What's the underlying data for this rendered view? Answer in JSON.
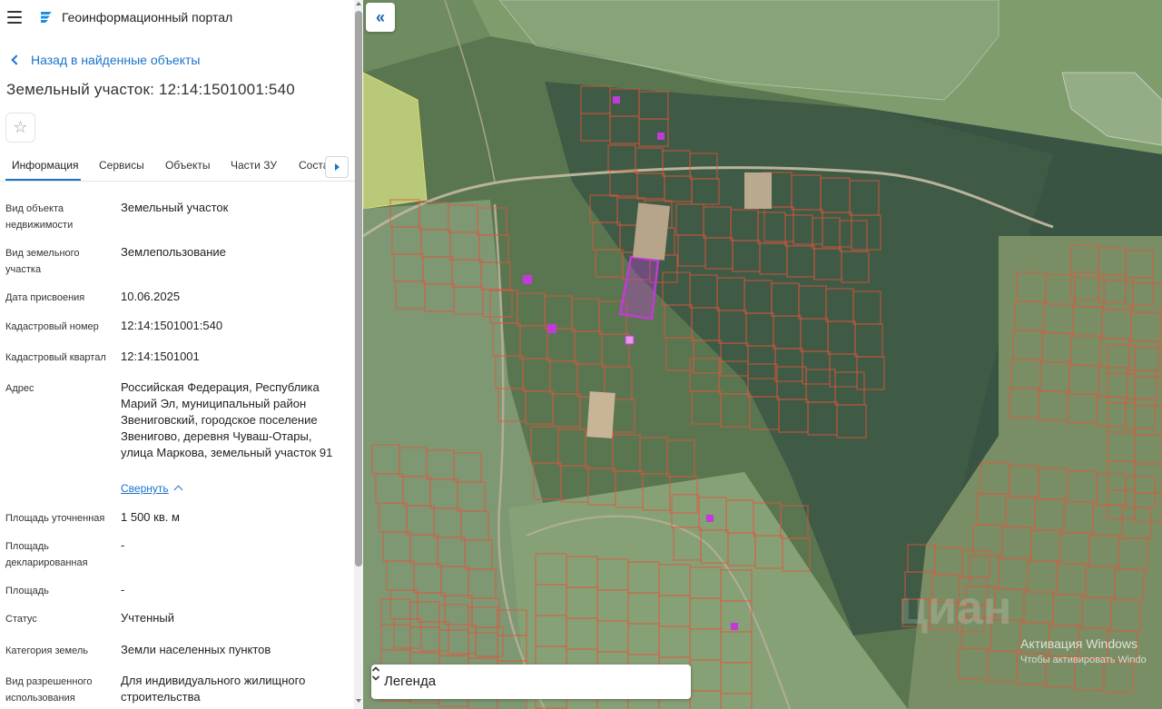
{
  "app": {
    "title": "Геоинформационный портал"
  },
  "nav": {
    "back_label": "Назад в найденные объекты"
  },
  "object": {
    "title": "Земельный участок: 12:14:1501001:540"
  },
  "tabs": [
    {
      "label": "Информация",
      "active": true
    },
    {
      "label": "Сервисы",
      "active": false
    },
    {
      "label": "Объекты",
      "active": false
    },
    {
      "label": "Части ЗУ",
      "active": false
    },
    {
      "label": "Соста",
      "active": false
    }
  ],
  "info_rows": [
    {
      "label": "Вид объекта недвижимости",
      "value": "Земельный участок"
    },
    {
      "label": "Вид земельного участка",
      "value": "Землепользование"
    },
    {
      "label": "Дата присвоения",
      "value": "10.06.2025"
    },
    {
      "label": "Кадастровый номер",
      "value": "12:14:1501001:540"
    },
    {
      "label": "Кадастровый квартал",
      "value": "12:14:1501001"
    },
    {
      "label": "Адрес",
      "value": "Российская Федерация, Республика Марий Эл, муниципальный район Звениговский, городское поселение Звенигово, деревня Чуваш-Отары, улица Маркова, земельный участок 91"
    },
    {
      "label": "Площадь уточненная",
      "value": "1 500 кв. м"
    },
    {
      "label": "Площадь декларированная",
      "value": "-"
    },
    {
      "label": "Площадь",
      "value": "-"
    },
    {
      "label": "Статус",
      "value": "Учтенный"
    },
    {
      "label": "Категория земель",
      "value": "Земли населенных пунктов"
    },
    {
      "label": "Вид разрешенного использования",
      "value": "Для индивидуального жилищного строительства"
    }
  ],
  "address_collapse_label": "Свернуть",
  "map": {
    "collapse_button_glyph": "«",
    "legend_label": "Легенда",
    "windows_activation_title": "Активация Windows",
    "windows_activation_hint": "Чтобы активировать Windo",
    "parcel_border_color": "#e0553a",
    "selected_parcel_color": "#c13bd6"
  },
  "colors": {
    "accent": "#1a73c9"
  }
}
